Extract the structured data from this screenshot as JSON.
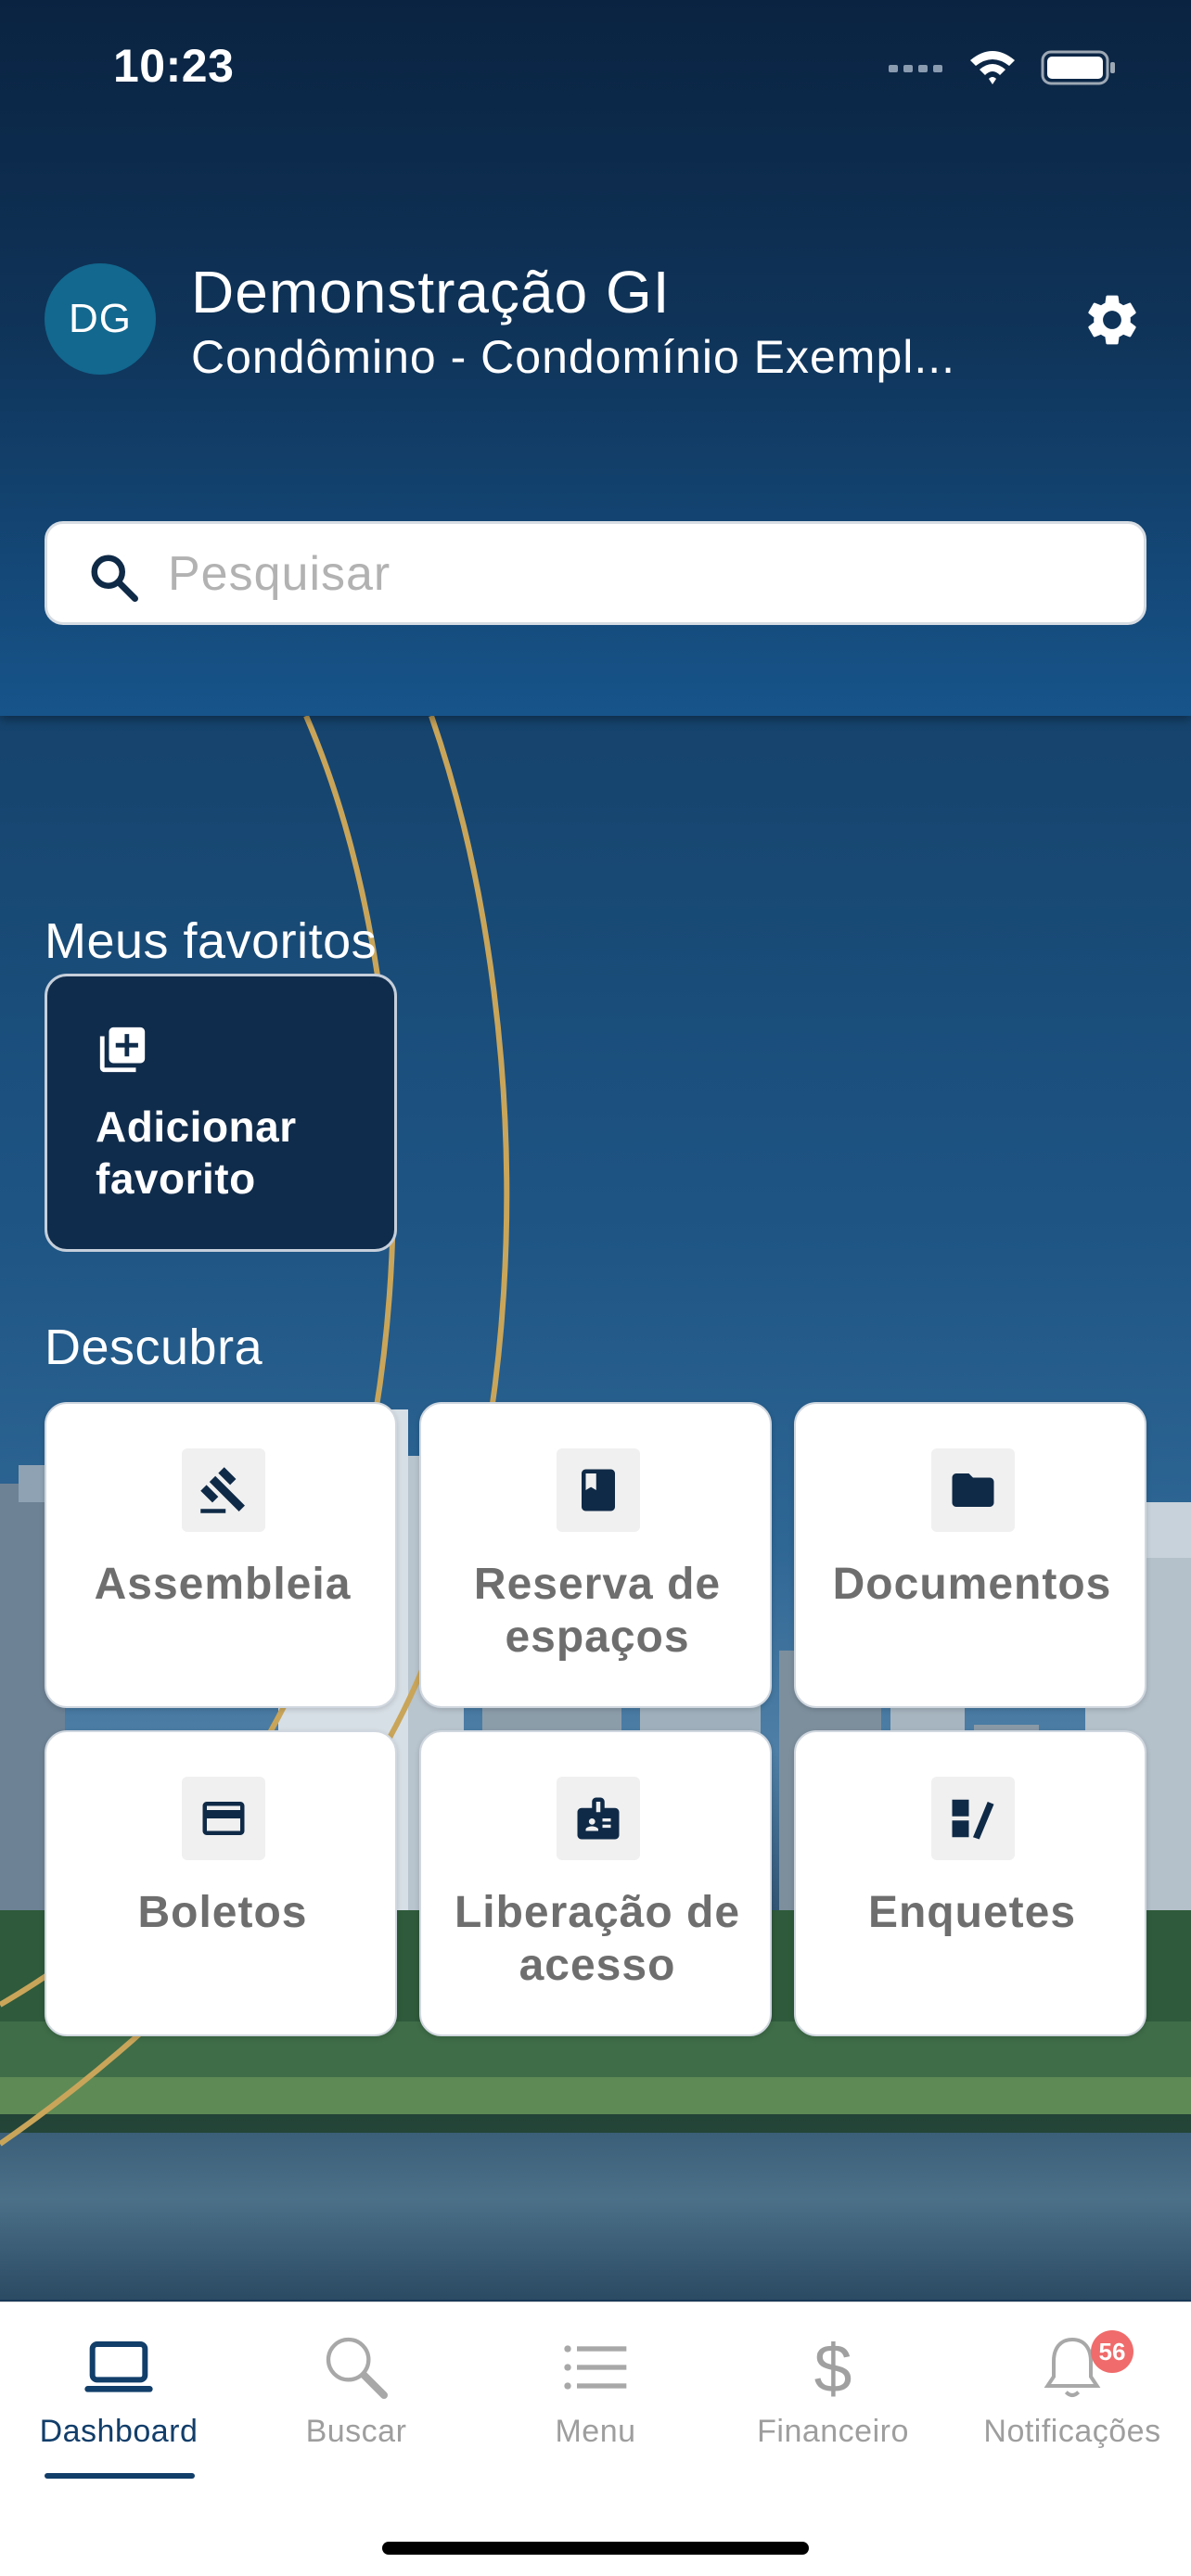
{
  "status_bar": {
    "time": "10:23"
  },
  "profile": {
    "initials": "DG",
    "name": "Demonstração GI",
    "subtitle": "Condômino - Condomínio Exempl..."
  },
  "search": {
    "placeholder": "Pesquisar",
    "value": ""
  },
  "favorites": {
    "title": "Meus favoritos",
    "add_label": "Adicionar favorito"
  },
  "discover": {
    "title": "Descubra",
    "items": [
      {
        "label": "Assembleia",
        "icon": "gavel-icon"
      },
      {
        "label": "Reserva de espaços",
        "icon": "book-icon"
      },
      {
        "label": "Documentos",
        "icon": "folder-icon"
      },
      {
        "label": "Boletos",
        "icon": "credit-card-icon"
      },
      {
        "label": "Liberação de acesso",
        "icon": "badge-icon"
      },
      {
        "label": "Enquetes",
        "icon": "poll-icon"
      }
    ]
  },
  "tabbar": {
    "tabs": [
      {
        "label": "Dashboard",
        "icon": "laptop-icon",
        "active": true
      },
      {
        "label": "Buscar",
        "icon": "magnifier-icon",
        "active": false
      },
      {
        "label": "Menu",
        "icon": "list-icon",
        "active": false
      },
      {
        "label": "Financeiro",
        "icon": "dollar-icon",
        "active": false
      },
      {
        "label": "Notificações",
        "icon": "bell-icon",
        "active": false
      }
    ],
    "notification_count": "56"
  },
  "colors": {
    "primary_dark": "#102c4c",
    "accent_blue": "#123e6a",
    "avatar_bg": "#12688f",
    "badge_red": "#f06b6b",
    "arc_gold": "#c9a55a"
  }
}
